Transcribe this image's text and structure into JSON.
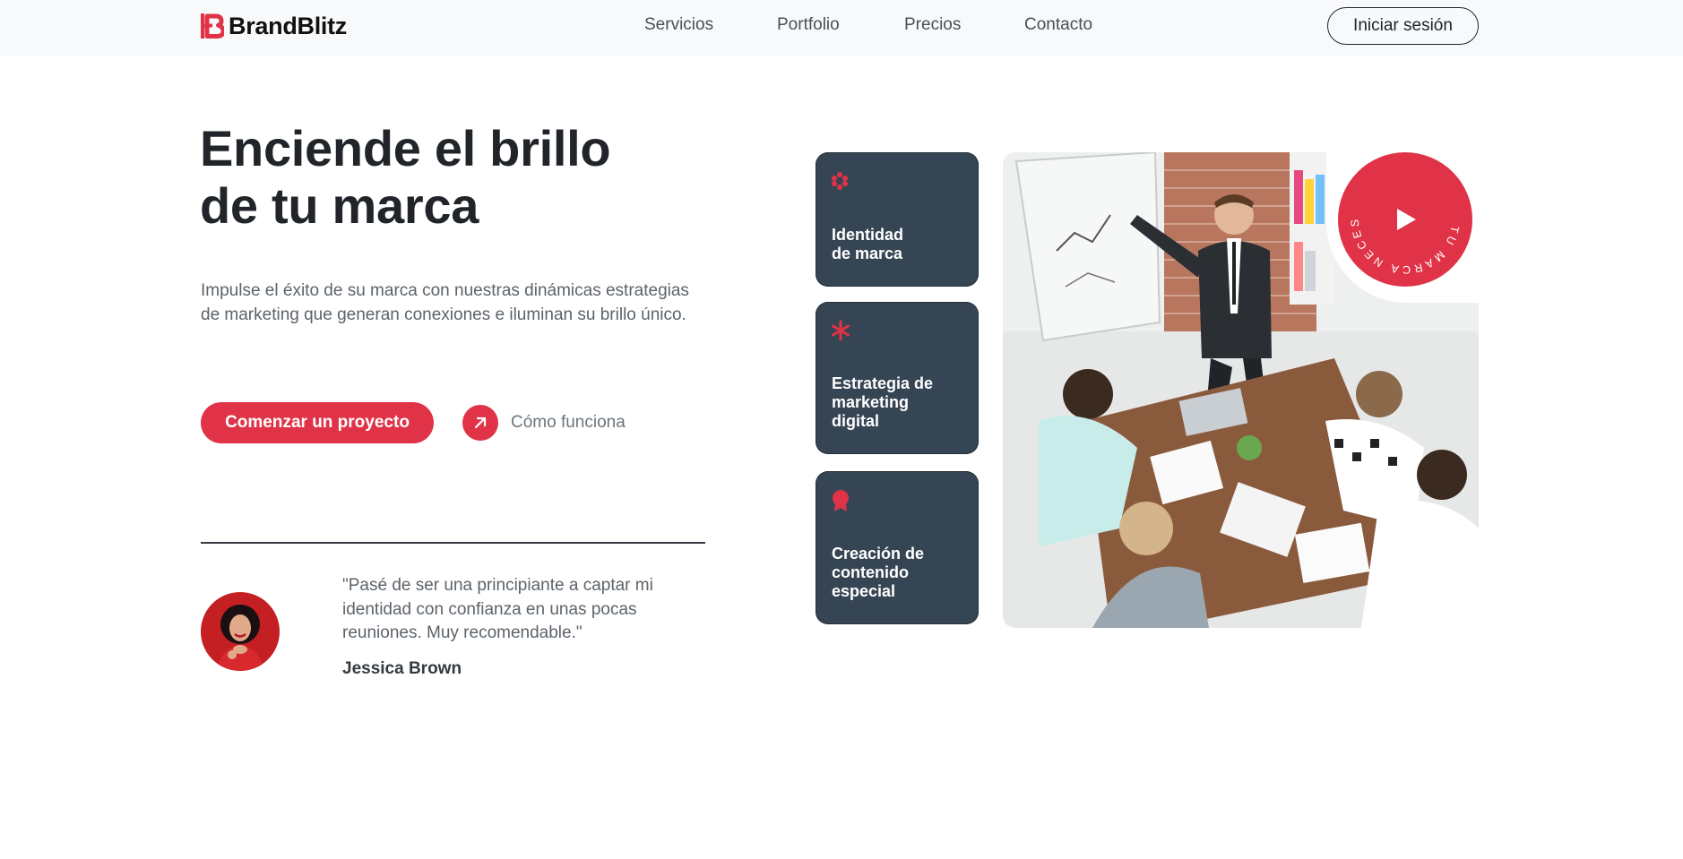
{
  "brand": {
    "name": "BrandBlitz",
    "accent": "#e03347",
    "dark": "#364553"
  },
  "nav": {
    "items": [
      {
        "label": "Servicios"
      },
      {
        "label": "Portfolio"
      },
      {
        "label": "Precios"
      },
      {
        "label": "Contacto"
      }
    ],
    "login_label": "Iniciar sesión"
  },
  "hero": {
    "title_line1": "Enciende el brillo",
    "title_line2": "de tu marca",
    "subtitle": "Impulse el éxito de su marca con nuestras dinámicas estrategias de marketing que generan conexiones e iluminan su brillo único.",
    "cta_label": "Comenzar un proyecto",
    "secondary_label": "Cómo funciona",
    "secondary_icon": "arrow-up-right-icon"
  },
  "testimonial": {
    "quote": "\"Pasé de ser una principiante a captar mi identidad con confianza en unas pocas reuniones. Muy recomendable.\"",
    "author": "Jessica Brown"
  },
  "services": [
    {
      "line1": "Identidad",
      "line2": "de marca",
      "icon": "sparkle-icon"
    },
    {
      "line1": "Estrategia de",
      "line2": "marketing",
      "line3": "digital",
      "icon": "asterisk-icon"
    },
    {
      "line1": "Creación de",
      "line2": "contenido",
      "line3": "especial",
      "icon": "award-icon"
    }
  ],
  "badge": {
    "circular_text": "TU MARCA NECESITA BRILLO",
    "icon": "play-icon"
  }
}
